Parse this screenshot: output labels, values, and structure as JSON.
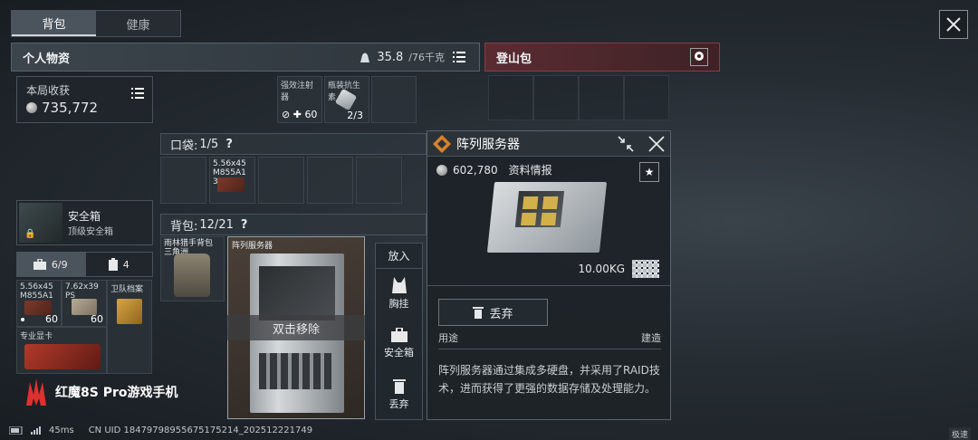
{
  "tabs": [
    {
      "label": "背包",
      "active": true
    },
    {
      "label": "健康",
      "active": false
    }
  ],
  "header": {
    "title": "个人物资",
    "weight_current": "35.8",
    "weight_max": "/76千克"
  },
  "right_header": {
    "title": "登山包"
  },
  "loot": {
    "label": "本局收获",
    "value": "735,772"
  },
  "top_items": [
    {
      "name": "强效注射器",
      "qty": "60"
    },
    {
      "name": "瓶装抗生素",
      "qty": "2/3"
    }
  ],
  "pocket": {
    "label": "口袋:",
    "count": "1/5",
    "help": "?"
  },
  "pocket_items": [
    {
      "name": "5.56x45\nM855A1",
      "qty": "30"
    }
  ],
  "bag": {
    "label": "背包:",
    "count": "12/21",
    "help": "?"
  },
  "bag_items": [
    {
      "name": "雨林猎手背包\n三角洲"
    },
    {
      "name": "阵列服务器"
    }
  ],
  "double_click_remove": "双击移除",
  "actions": {
    "title": "放入",
    "items": [
      {
        "label": "胸挂"
      },
      {
        "label": "安全箱"
      },
      {
        "label": "丢弃"
      }
    ]
  },
  "safe": {
    "name": "安全箱",
    "sub": "顶级安全箱"
  },
  "counts": [
    {
      "value": "6/9",
      "active": true
    },
    {
      "value": "4",
      "active": false
    }
  ],
  "safe_items": [
    {
      "name": "5.56x45\nM855A1",
      "qty": "60"
    },
    {
      "name": "7.62x39\nPS",
      "qty": "60"
    },
    {
      "name": "卫队档案",
      "qty": ""
    },
    {
      "name": "专业显卡",
      "qty": ""
    }
  ],
  "popup": {
    "title": "阵列服务器",
    "price": "602,780",
    "info_label": "资料情报",
    "weight": "10.00KG",
    "discard": "丢弃",
    "usage_label": "用途",
    "build_label": "建造",
    "description": "阵列服务器通过集成多硬盘，并采用了RAID技术，进而获得了更强的数据存储及处理能力。"
  },
  "watermark": "红魔8S Pro游戏手机",
  "status": {
    "ping": "45ms",
    "uid": "CN UID 18479798955675175214_202512221749",
    "fast": "极速"
  },
  "colors": {
    "accent_red": "#8a3b44",
    "brand_red": "#e03030"
  }
}
